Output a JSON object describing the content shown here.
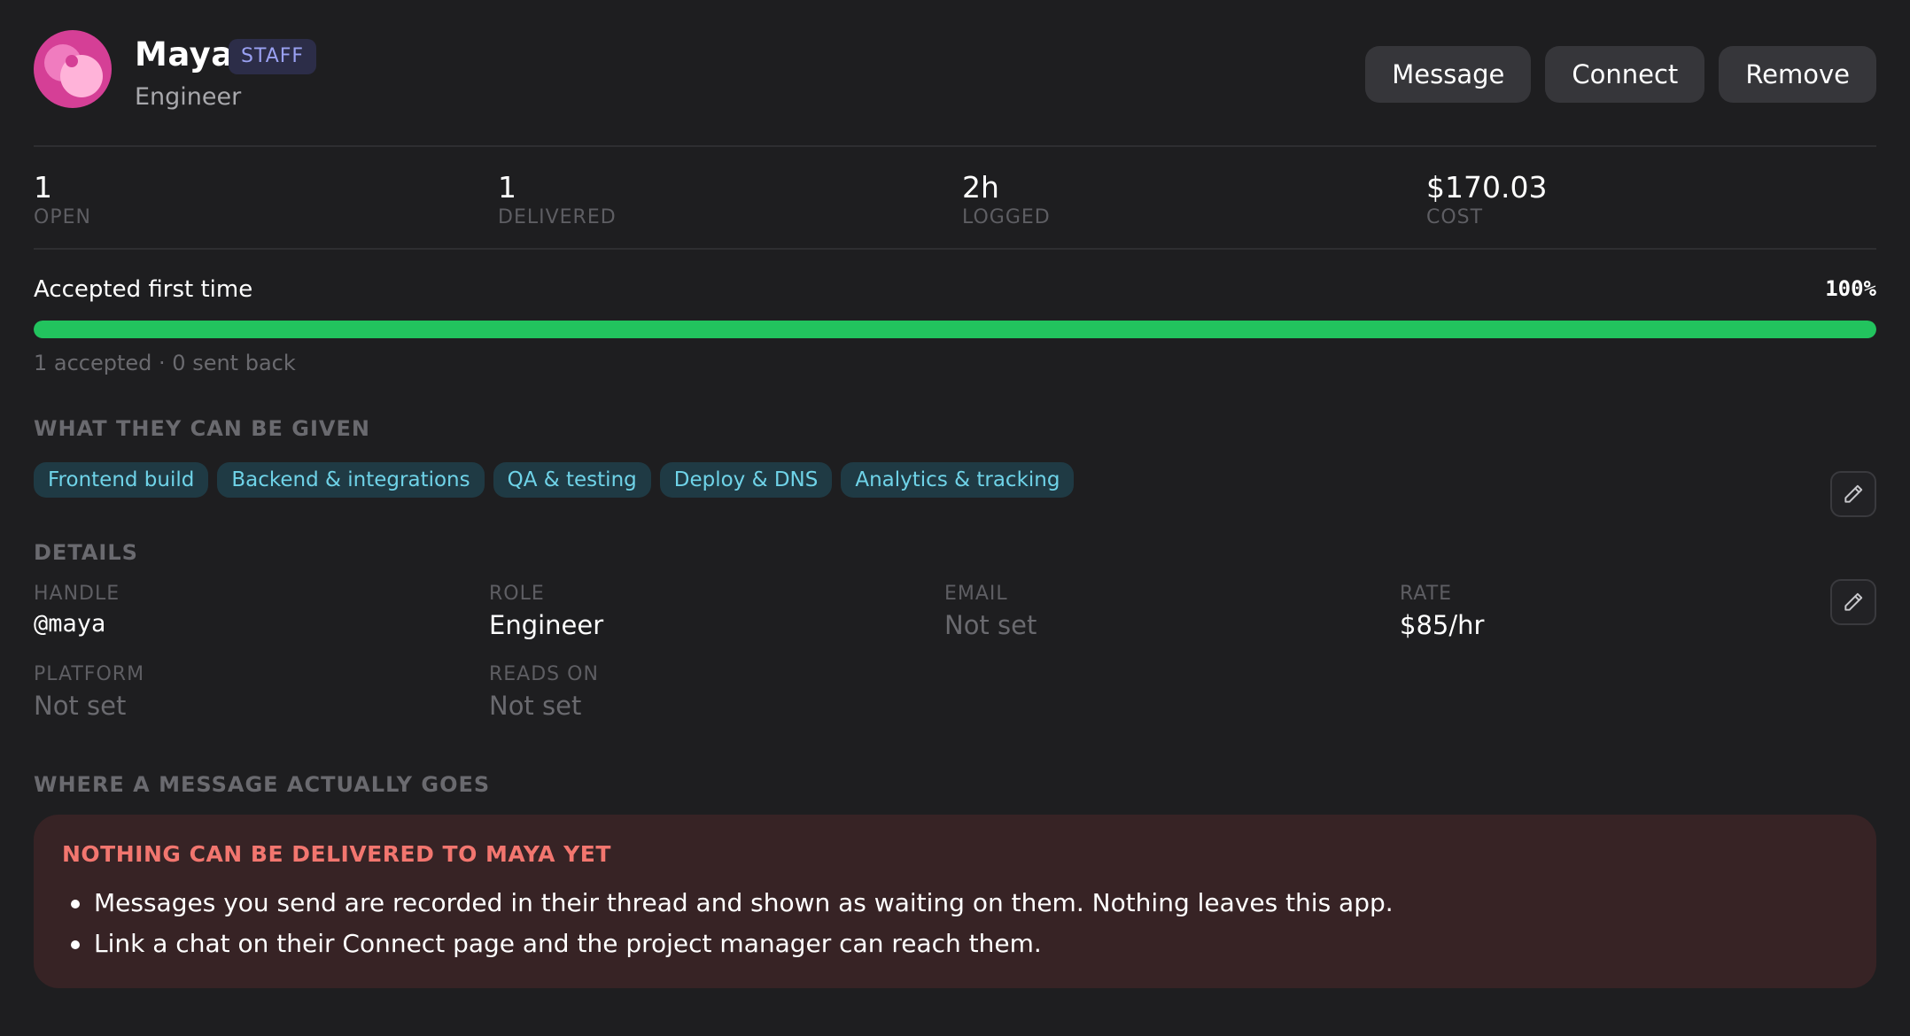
{
  "profile": {
    "name": "Maya",
    "badge": "STAFF",
    "role": "Engineer"
  },
  "actions": {
    "message": "Message",
    "connect": "Connect",
    "remove": "Remove"
  },
  "stats": [
    {
      "value": "1",
      "label": "OPEN"
    },
    {
      "value": "1",
      "label": "DELIVERED"
    },
    {
      "value": "2h",
      "label": "LOGGED"
    },
    {
      "value": "$170.03",
      "label": "COST"
    }
  ],
  "acceptance": {
    "label": "Accepted first time",
    "percent_text": "100%",
    "fraction": 1.0,
    "summary": "1 accepted · 0 sent back"
  },
  "capabilities": {
    "title": "WHAT THEY CAN BE GIVEN",
    "tags": [
      "Frontend build",
      "Backend & integrations",
      "QA & testing",
      "Deploy & DNS",
      "Analytics & tracking"
    ]
  },
  "details": {
    "title": "DETAILS",
    "handle": {
      "label": "HANDLE",
      "value": "@maya"
    },
    "role": {
      "label": "ROLE",
      "value": "Engineer"
    },
    "email": {
      "label": "EMAIL",
      "value": "Not set"
    },
    "rate": {
      "label": "RATE",
      "value": "$85/hr"
    },
    "platform": {
      "label": "PLATFORM",
      "value": "Not set"
    },
    "reads_on": {
      "label": "READS ON",
      "value": "Not set"
    }
  },
  "delivery": {
    "title": "WHERE A MESSAGE ACTUALLY GOES",
    "warning_title": "NOTHING CAN BE DELIVERED TO MAYA YET",
    "bullets": [
      "Messages you send are recorded in their thread and shown as waiting on them. Nothing leaves this app.",
      "Link a chat on their Connect page and the project manager can reach them."
    ]
  },
  "colors": {
    "background": "#1e1e20",
    "accent_green": "#22c35e",
    "tag_text": "#6fd3e8",
    "warning_text": "#f2766f",
    "avatar": "#d53f96"
  },
  "icons": [
    "pencil-icon"
  ]
}
